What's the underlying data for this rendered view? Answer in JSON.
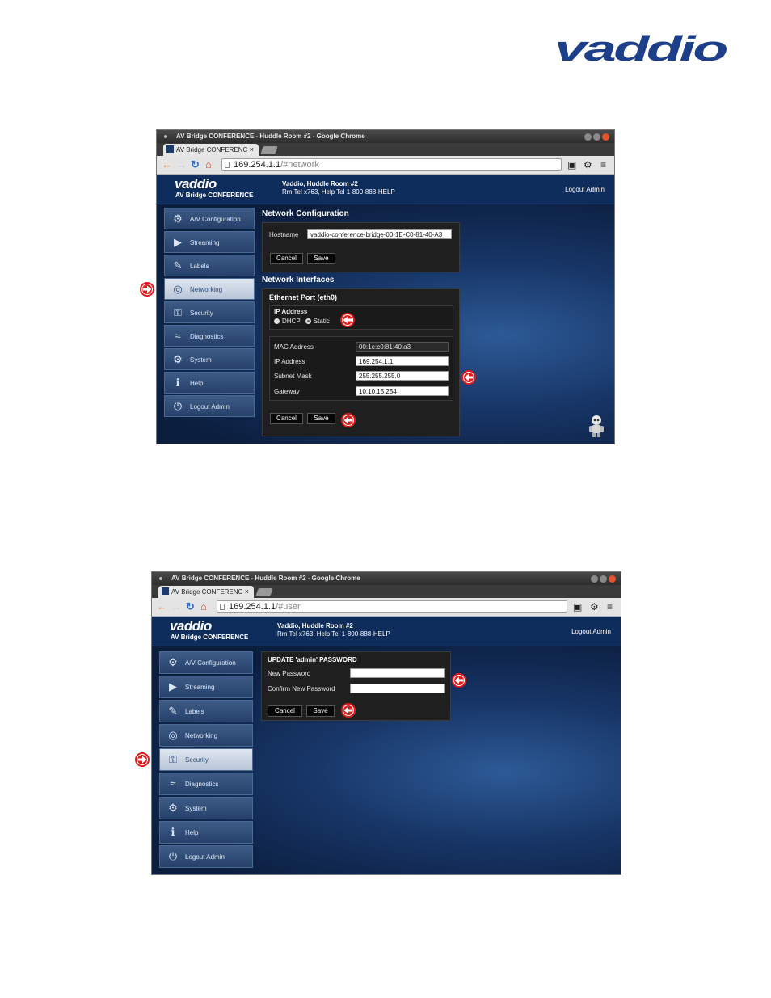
{
  "document": {
    "brand_logo_text": "vaddio"
  },
  "screenshots": [
    {
      "window_title": "AV Bridge CONFERENCE - Huddle Room #2 - Google Chrome",
      "tab_label": "AV Bridge CONFERENC",
      "tab_close": "×",
      "url_host": "169.254.1.1",
      "url_path": "/#network",
      "brand": "vaddio",
      "product": "AV Bridge CONFERENCE",
      "device_name": "Vaddio, Huddle Room #2",
      "device_info": "Rm Tel x763, Help Tel 1-800-888-HELP",
      "logout_link": "Logout Admin",
      "nav": [
        {
          "label": "A/V Configuration",
          "icon": "av-configuration-icon",
          "active": false
        },
        {
          "label": "Streaming",
          "icon": "streaming-icon",
          "active": false
        },
        {
          "label": "Labels",
          "icon": "labels-icon",
          "active": false
        },
        {
          "label": "Networking",
          "icon": "networking-icon",
          "active": true
        },
        {
          "label": "Security",
          "icon": "security-icon",
          "active": false
        },
        {
          "label": "Diagnostics",
          "icon": "diagnostics-icon",
          "active": false
        },
        {
          "label": "System",
          "icon": "system-icon",
          "active": false
        },
        {
          "label": "Help",
          "icon": "help-icon",
          "active": false
        },
        {
          "label": "Logout Admin",
          "icon": "logout-icon",
          "active": false
        }
      ],
      "network_config": {
        "title": "Network Configuration",
        "hostname_label": "Hostname",
        "hostname_value": "vaddio-conference-bridge-00-1E-C0-81-40-A3",
        "cancel": "Cancel",
        "save": "Save"
      },
      "network_interfaces": {
        "title": "Network Interfaces",
        "port_title": "Ethernet Port (eth0)",
        "ip_group_title": "IP Address",
        "dhcp_label": "DHCP",
        "static_label": "Static",
        "selected_mode": "Static",
        "mac_label": "MAC Address",
        "mac_value": "00:1e:c0:81:40:a3",
        "ip_label": "IP Address",
        "ip_value": "169.254.1.1",
        "mask_label": "Subnet Mask",
        "mask_value": "255.255.255.0",
        "gateway_label": "Gateway",
        "gateway_value": "10.10.15.254",
        "cancel": "Cancel",
        "save": "Save"
      }
    },
    {
      "window_title": "AV Bridge CONFERENCE - Huddle Room #2 - Google Chrome",
      "tab_label": "AV Bridge CONFERENC",
      "tab_close": "×",
      "url_host": "169.254.1.1",
      "url_path": "/#user",
      "brand": "vaddio",
      "product": "AV Bridge CONFERENCE",
      "device_name": "Vaddio, Huddle Room #2",
      "device_info": "Rm Tel x763, Help Tel 1-800-888-HELP",
      "logout_link": "Logout Admin",
      "nav": [
        {
          "label": "A/V Configuration",
          "icon": "av-configuration-icon",
          "active": false
        },
        {
          "label": "Streaming",
          "icon": "streaming-icon",
          "active": false
        },
        {
          "label": "Labels",
          "icon": "labels-icon",
          "active": false
        },
        {
          "label": "Networking",
          "icon": "networking-icon",
          "active": false
        },
        {
          "label": "Security",
          "icon": "security-icon",
          "active": true
        },
        {
          "label": "Diagnostics",
          "icon": "diagnostics-icon",
          "active": false
        },
        {
          "label": "System",
          "icon": "system-icon",
          "active": false
        },
        {
          "label": "Help",
          "icon": "help-icon",
          "active": false
        },
        {
          "label": "Logout Admin",
          "icon": "logout-icon",
          "active": false
        }
      ],
      "password_form": {
        "title": "UPDATE 'admin' PASSWORD",
        "new_label": "New Password",
        "new_value": "",
        "confirm_label": "Confirm New Password",
        "confirm_value": "",
        "cancel": "Cancel",
        "save": "Save"
      }
    }
  ],
  "colors": {
    "arrow_red": "#e01b1b",
    "logo_blue": "#1d3f8a",
    "header_blue": "#0f2d5c"
  }
}
